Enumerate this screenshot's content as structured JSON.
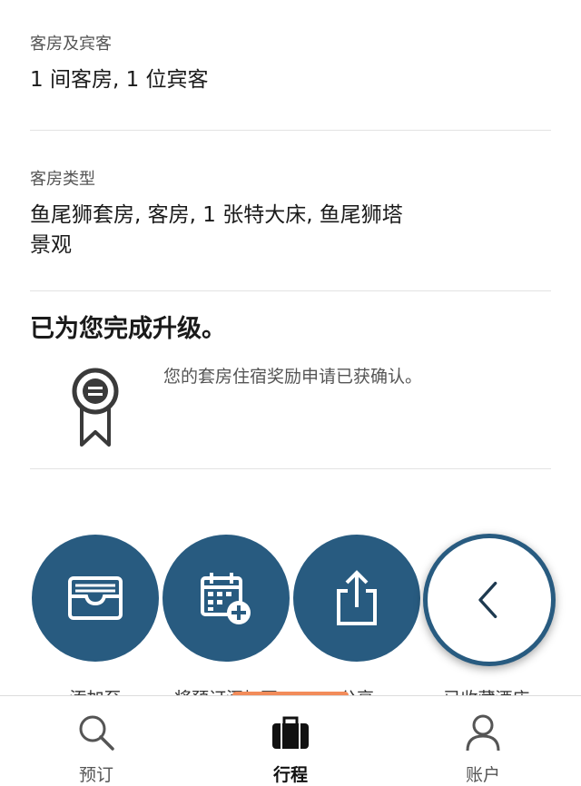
{
  "rooms_guests": {
    "label": "客房及宾客",
    "value": "1 间客房, 1 位宾客"
  },
  "room_type": {
    "label": "客房类型",
    "value_line1": "鱼尾狮套房, 客房, 1  张特大床, 鱼尾狮塔",
    "value_line2": "景观"
  },
  "upgrade": {
    "title": "已为您完成升级。",
    "description": "您的套房住宿奖励申请已获确认。",
    "icon": "ribbon-badge-icon"
  },
  "actions": [
    {
      "label": "添加至",
      "icon": "wallet-icon"
    },
    {
      "label": "将预订添加至",
      "icon": "calendar-add-icon"
    },
    {
      "label": "分享",
      "icon": "share-icon"
    },
    {
      "label": "已收藏酒店",
      "icon": "chevron-left-icon"
    }
  ],
  "tabbar": {
    "tabs": [
      {
        "label": "预订",
        "icon": "search-icon",
        "active": false
      },
      {
        "label": "行程",
        "icon": "suitcase-icon",
        "active": true
      },
      {
        "label": "账户",
        "icon": "person-icon",
        "active": false
      }
    ]
  },
  "colors": {
    "brand": "#285b80",
    "accent": "#f28c5a"
  }
}
